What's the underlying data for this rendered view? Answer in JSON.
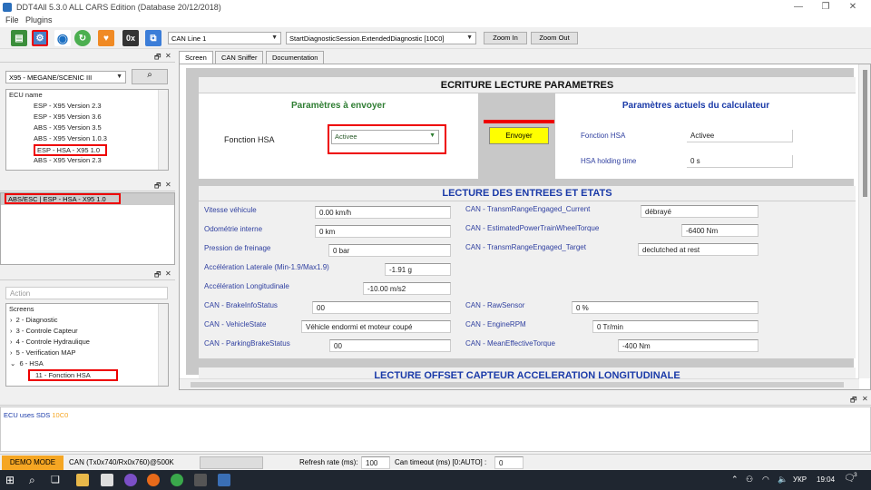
{
  "window": {
    "title": "DDT4All 5.3.0 ALL CARS Edition (Database 20/12/2018)",
    "minimize": "—",
    "restore": "❐",
    "close": "✕"
  },
  "menu": [
    "File",
    "Plugins"
  ],
  "toolbar": {
    "can_line": "CAN Line 1",
    "session": "StartDiagnosticSession.ExtendedDiagnostic [10C0]",
    "zoom_in": "Zoom In",
    "zoom_out": "Zoom Out",
    "hex_label": "0x"
  },
  "left": {
    "vehicle": "X95 - MEGANE/SCENIC III",
    "ecu_header": "ECU name",
    "ecu_list": [
      "ESP - X95 Version 2.3",
      "ESP - X95 Version 3.6",
      "ABS - X95 Version 3.5",
      "ABS - X95 Version 1.0.3",
      "ESP - HSA - X95 1.0",
      "ABS - X95 Version 2.3"
    ],
    "selected_ecu": "ABS/ESC | ESP - HSA - X95 1.0",
    "action_label": "Action",
    "screens_header": "Screens",
    "screens": [
      "2 - Diagnostic",
      "3 - Controle Capteur",
      "4 - Controle Hydraulique",
      "5 - Verification MAP",
      "6 - HSA",
      "11 - Fonction HSA"
    ]
  },
  "tabs": [
    "Screen",
    "CAN Sniffer",
    "Documentation"
  ],
  "screen": {
    "title": "ECRITURE LECTURE PARAMETRES",
    "send_title": "Paramètres à envoyer",
    "current_title": "Paramètres actuels du calculateur",
    "fonction_label": "Fonction HSA",
    "fonction_value": "Activee",
    "send_button": "Envoyer",
    "current_fonction_label": "Fonction HSA",
    "current_fonction_value": "Activee",
    "holding_label": "HSA holding time",
    "holding_value": "0 s",
    "lecture_title": "LECTURE DES ENTREES ET ETATS",
    "left_rows": [
      {
        "label": "Vitesse véhicule",
        "value": "0.00 km/h"
      },
      {
        "label": "Odométrie interne",
        "value": "0 km"
      },
      {
        "label": "Pression de freinage",
        "value": "0 bar"
      },
      {
        "label": "Accélération Laterale (Min-1.9/Max1.9)",
        "value": "-1.91 g"
      },
      {
        "label": "Accélération Longitudinale",
        "value": "-10.00 m/s2"
      },
      {
        "label": "CAN - BrakeInfoStatus",
        "value": "00"
      },
      {
        "label": "CAN - VehicleState",
        "value": "Véhicle endormi et moteur coupé"
      },
      {
        "label": "CAN - ParkingBrakeStatus",
        "value": "00"
      }
    ],
    "right_rows": [
      {
        "label": "CAN - TransmRangeEngaged_Current",
        "value": "débrayé"
      },
      {
        "label": "CAN - EstimatedPowerTrainWheelTorque",
        "value": "-6400 Nm"
      },
      {
        "label": "CAN - TransmRangeEngaged_Target",
        "value": "declutched at rest"
      },
      {
        "label": "CAN - RawSensor",
        "value": "0 %"
      },
      {
        "label": "CAN - EngineRPM",
        "value": "0 Tr/min"
      },
      {
        "label": "CAN - MeanEffectiveTorque",
        "value": "-400 Nm"
      }
    ],
    "offset_title": "LECTURE OFFSET CAPTEUR ACCELERATION LONGITUDINALE"
  },
  "log": {
    "text": "ECU uses SDS",
    "code": "10C0"
  },
  "status": {
    "demo": "DEMO MODE",
    "can": "CAN (Tx0x740/Rx0x760)@500K",
    "refresh_label": "Refresh rate (ms):",
    "refresh_value": "100",
    "timeout_label": "Can timeout (ms) [0:AUTO] :",
    "timeout_value": "0"
  },
  "taskbar": {
    "lang": "УКР",
    "time": "19:04",
    "notif_count": "3"
  },
  "colors": {
    "accent_green": "#2e7d32",
    "accent_blue": "#1a3aa8",
    "send_yellow": "#ffff00",
    "demo_orange": "#f5a623",
    "highlight_red": "#e00000"
  }
}
